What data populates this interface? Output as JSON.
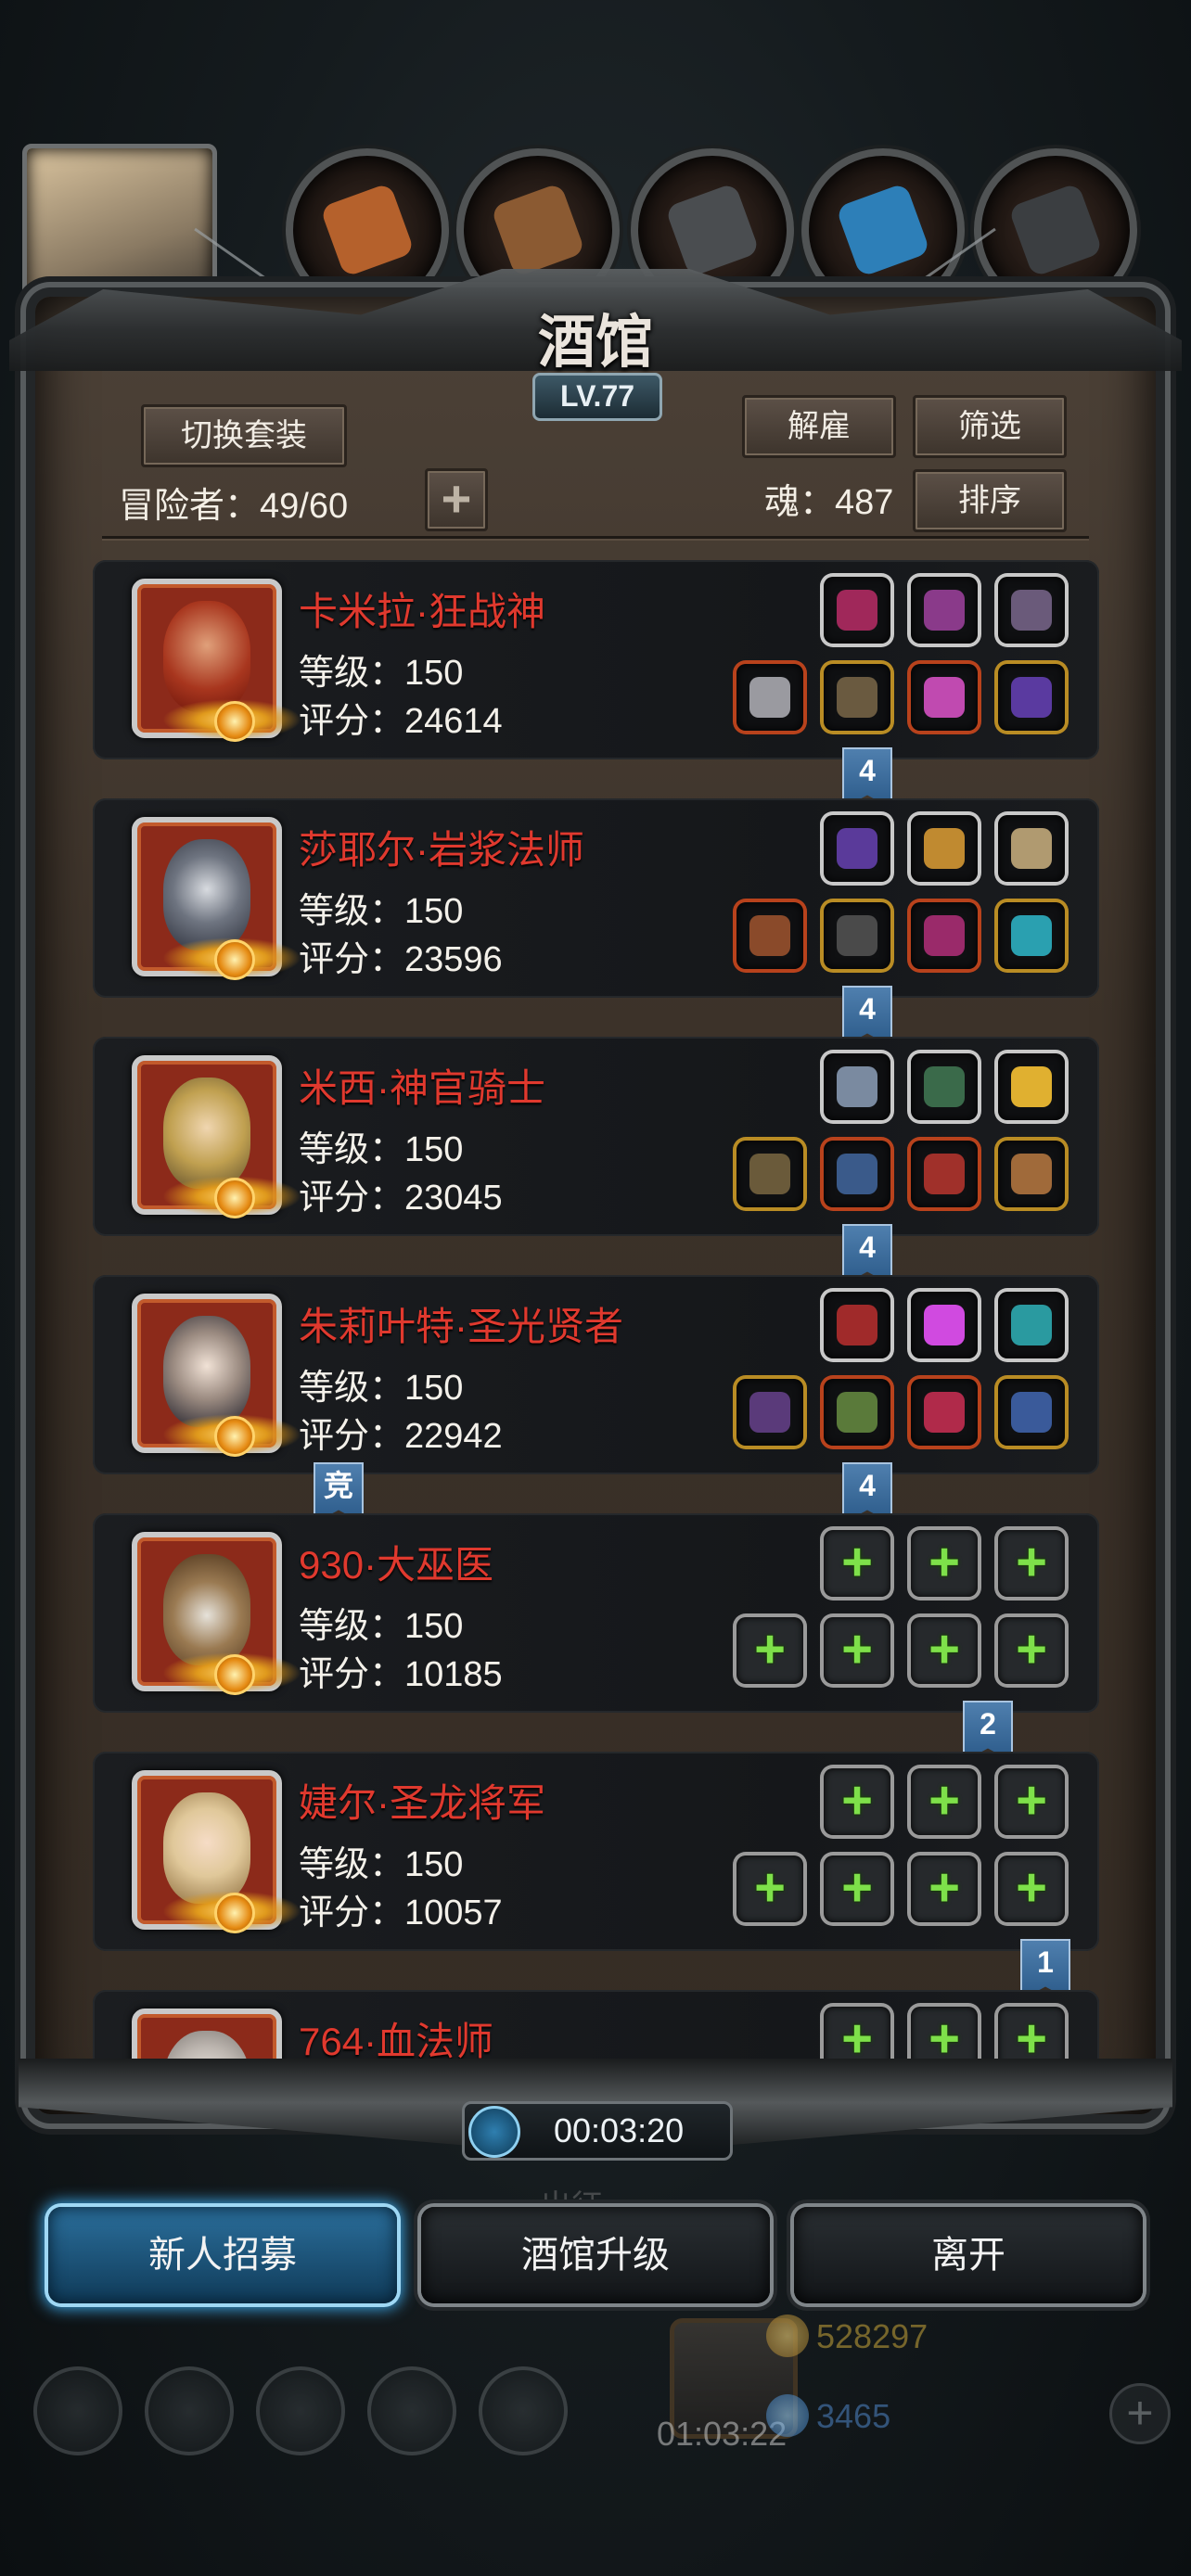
{
  "title": "酒馆",
  "level": "LV.77",
  "buttons": {
    "switch_outfit": "切换套装",
    "dismiss": "解雇",
    "filter": "筛选",
    "sort": "排序",
    "add": "+"
  },
  "adventurers_label": "冒险者：49/60",
  "soul_label": "魂：487",
  "heroes": [
    {
      "name": "卡米拉·狂战神",
      "level": "等级：150",
      "score": "评分：24614",
      "flag": "4",
      "top_slots": [
        {
          "color": "#a0285a",
          "frame": "silver"
        },
        {
          "color": "#8a3a8a",
          "frame": "silver"
        },
        {
          "color": "#6a5a7a",
          "frame": "silver"
        }
      ],
      "bottom_slots": [
        {
          "color": "#9a9aa0",
          "frame": "red"
        },
        {
          "color": "#6a5a40",
          "frame": "gold"
        },
        {
          "color": "#c04ab0",
          "frame": "red"
        },
        {
          "color": "#5a3aa0",
          "frame": "gold"
        }
      ]
    },
    {
      "name": "莎耶尔·岩浆法师",
      "level": "等级：150",
      "score": "评分：23596",
      "flag": "4",
      "top_slots": [
        {
          "color": "#5a3a9a",
          "frame": "silver"
        },
        {
          "color": "#c08a30",
          "frame": "silver"
        },
        {
          "color": "#b09a70",
          "frame": "silver"
        }
      ],
      "bottom_slots": [
        {
          "color": "#8a4a2a",
          "frame": "red"
        },
        {
          "color": "#4a4a4a",
          "frame": "gold"
        },
        {
          "color": "#9a2a6a",
          "frame": "red"
        },
        {
          "color": "#2aa0b0",
          "frame": "gold"
        }
      ]
    },
    {
      "name": "米西·神官骑士",
      "level": "等级：150",
      "score": "评分：23045",
      "flag": "4",
      "top_slots": [
        {
          "color": "#7a8aa0",
          "frame": "silver"
        },
        {
          "color": "#3a6a4a",
          "frame": "silver"
        },
        {
          "color": "#e0b030",
          "frame": "silver"
        }
      ],
      "bottom_slots": [
        {
          "color": "#6a5a3a",
          "frame": "gold"
        },
        {
          "color": "#3a5a8a",
          "frame": "red"
        },
        {
          "color": "#a0302a",
          "frame": "red"
        },
        {
          "color": "#a06a3a",
          "frame": "gold"
        }
      ]
    },
    {
      "name": "朱莉叶特·圣光贤者",
      "level": "等级：150",
      "score": "评分：22942",
      "flag": "4",
      "side_flag": "竞",
      "top_slots": [
        {
          "color": "#a02a2a",
          "frame": "silver"
        },
        {
          "color": "#d04ae0",
          "frame": "silver"
        },
        {
          "color": "#2a9aa0",
          "frame": "silver"
        }
      ],
      "bottom_slots": [
        {
          "color": "#5a3a7a",
          "frame": "gold"
        },
        {
          "color": "#5a7a3a",
          "frame": "red"
        },
        {
          "color": "#b02a4a",
          "frame": "red"
        },
        {
          "color": "#3a5a9a",
          "frame": "gold"
        }
      ]
    },
    {
      "name": "930·大巫医",
      "level": "等级：150",
      "score": "评分：10185",
      "flag": "2",
      "empty": true
    },
    {
      "name": "婕尔·圣龙将军",
      "level": "等级：150",
      "score": "评分：10057",
      "flag": "1",
      "empty": true
    },
    {
      "name": "764·血法师",
      "level": "",
      "score": "",
      "flag": "",
      "empty": true,
      "partial": true
    }
  ],
  "timer": "00:03:20",
  "bottom": {
    "recruit": "新人招募",
    "upgrade": "酒馆升级",
    "leave": "离开"
  },
  "background": {
    "gold": "528297",
    "gems": "3465",
    "gift_timer": "01:03:22",
    "march": "出征"
  },
  "colors": {
    "accent_red": "#e0392e",
    "plus_green": "#7ee04a",
    "primary_blue": "#2b6f9c"
  }
}
